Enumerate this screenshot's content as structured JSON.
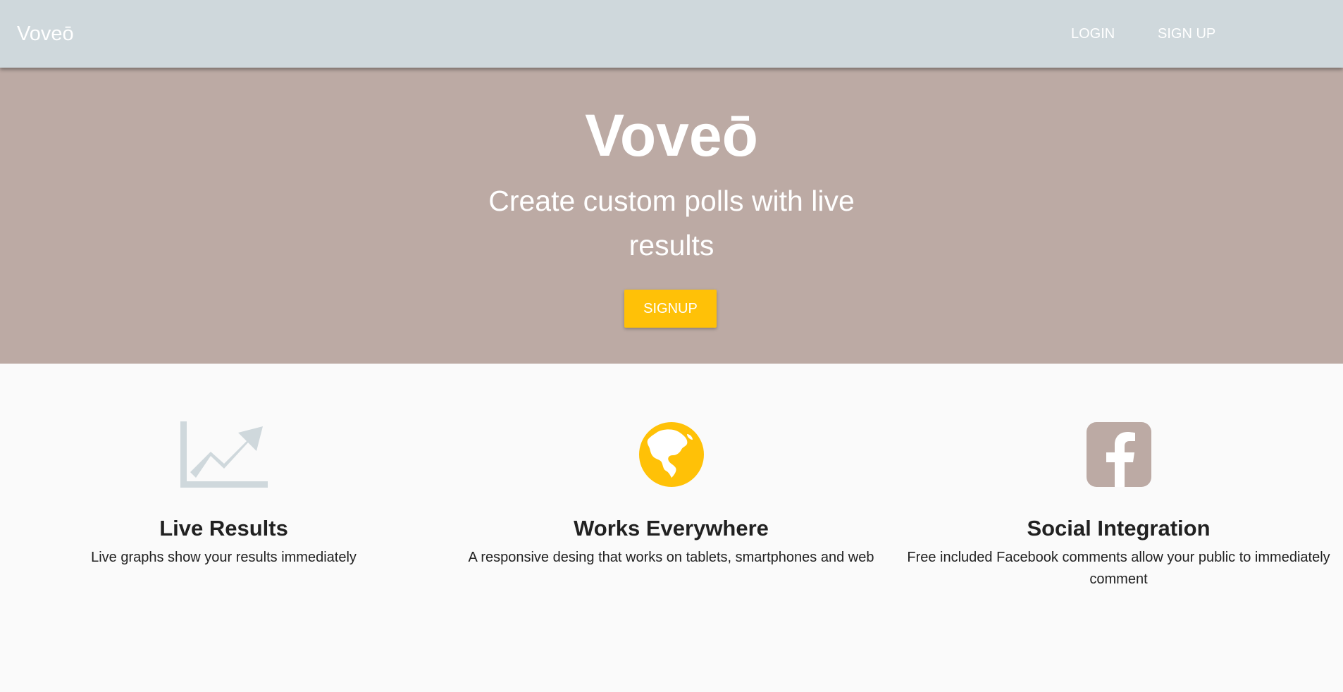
{
  "navbar": {
    "brand": "Voveō",
    "links": [
      {
        "label": "LOGIN"
      },
      {
        "label": "SIGN UP"
      }
    ]
  },
  "hero": {
    "title": "Voveō",
    "subtitle": "Create custom polls with live results",
    "button_label": "SIGNUP",
    "background_color": "#bcaaa4",
    "button_color": "#ffc107"
  },
  "features": [
    {
      "icon": "trending-up-chart-icon",
      "title": "Live Results",
      "description": "Live graphs show your results immediately"
    },
    {
      "icon": "globe-americas-icon",
      "title": "Works Everywhere",
      "description": "A responsive desing that works on tablets, smartphones and web"
    },
    {
      "icon": "facebook-icon",
      "title": "Social Integration",
      "description": "Free included Facebook comments allow your public to immediately comment"
    }
  ],
  "colors": {
    "navbar": "#cfd8dc",
    "accent": "#ffc107",
    "hero": "#bcaaa4",
    "page": "#fafafa"
  }
}
